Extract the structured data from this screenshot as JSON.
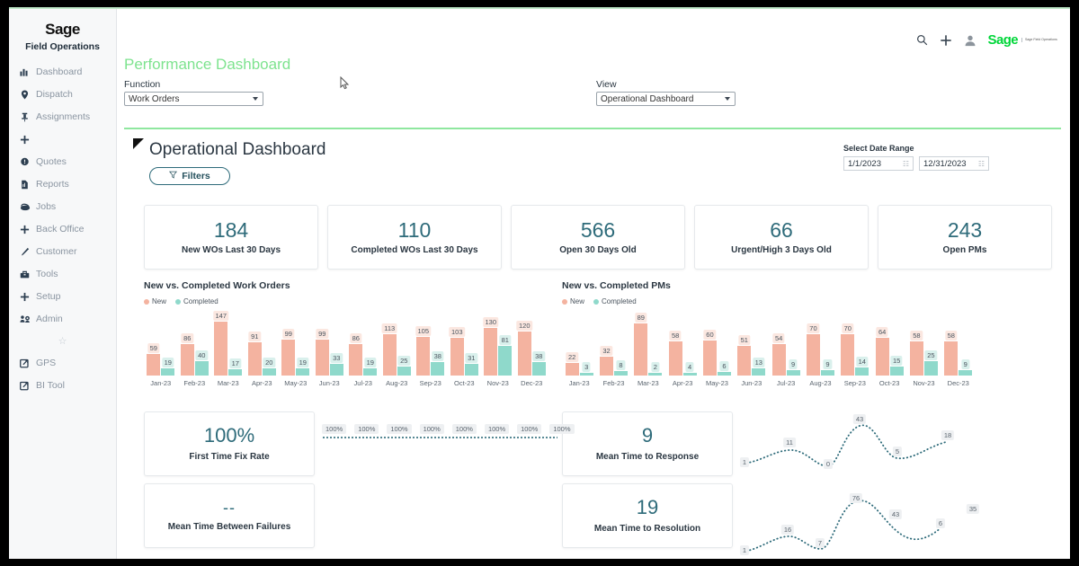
{
  "brand": {
    "logo": "Sage",
    "subtitle": "Field Operations"
  },
  "sidebar": {
    "items": [
      {
        "label": "Dashboard",
        "icon": "chart-bar-icon"
      },
      {
        "label": "Dispatch",
        "icon": "map-pin-icon"
      },
      {
        "label": "Assignments",
        "icon": "pin-icon"
      },
      {
        "label": "",
        "icon": "plus-icon"
      },
      {
        "label": "Quotes",
        "icon": "comment-icon"
      },
      {
        "label": "Reports",
        "icon": "document-icon"
      },
      {
        "label": "Jobs",
        "icon": "briefcase-icon"
      },
      {
        "label": "Back Office",
        "icon": "plus-icon"
      },
      {
        "label": "Customer",
        "icon": "pencil-icon"
      },
      {
        "label": "Tools",
        "icon": "toolbox-icon"
      },
      {
        "label": "Setup",
        "icon": "plus-icon"
      },
      {
        "label": "Admin",
        "icon": "people-gear-icon"
      }
    ],
    "favorite_icon": "star-icon",
    "external": [
      {
        "label": "GPS",
        "icon": "external-link-icon"
      },
      {
        "label": "BI Tool",
        "icon": "external-link-icon"
      }
    ]
  },
  "header": {
    "page_title": "Performance Dashboard",
    "icons": [
      "search-icon",
      "plus-icon",
      "user-avatar-icon"
    ],
    "logo_text": "Sage",
    "logo_sub": "Sage Field Operations"
  },
  "filters": {
    "function_label": "Function",
    "function_value": "Work Orders",
    "view_label": "View",
    "view_value": "Operational Dashboard"
  },
  "dashboard": {
    "title": "Operational Dashboard",
    "filters_button": "Filters",
    "filters_icon": "funnel-icon",
    "date_range_label": "Select Date Range",
    "date_from": "1/1/2023",
    "date_to": "12/31/2023",
    "calendar_icon": "calendar-icon"
  },
  "kpis": [
    {
      "value": "184",
      "label": "New WOs Last 30 Days"
    },
    {
      "value": "110",
      "label": "Completed WOs Last 30 Days"
    },
    {
      "value": "566",
      "label": "Open 30 Days Old"
    },
    {
      "value": "66",
      "label": "Urgent/High 3 Days Old"
    },
    {
      "value": "243",
      "label": "Open PMs"
    }
  ],
  "metric_cards": [
    {
      "value": "100%",
      "label": "First Time Fix Rate"
    },
    {
      "value": "--",
      "label": "Mean Time Between Failures"
    },
    {
      "value": "9",
      "label": "Mean Time to Response"
    },
    {
      "value": "19",
      "label": "Mean Time to Resolution"
    }
  ],
  "colors": {
    "accent_green": "#7ee38f",
    "teal": "#2e6b7a",
    "series_new": "#f4b3a0",
    "series_completed": "#8fd9cb"
  },
  "chart_data": [
    {
      "type": "bar",
      "title": "New vs. Completed Work Orders",
      "categories": [
        "Jan-23",
        "Feb-23",
        "Mar-23",
        "Apr-23",
        "May-23",
        "Jun-23",
        "Jul-23",
        "Aug-23",
        "Sep-23",
        "Oct-23",
        "Nov-23",
        "Dec-23"
      ],
      "series": [
        {
          "name": "New",
          "values": [
            59,
            86,
            147,
            91,
            99,
            99,
            86,
            113,
            105,
            103,
            130,
            120
          ]
        },
        {
          "name": "Completed",
          "values": [
            19,
            40,
            17,
            20,
            19,
            33,
            19,
            25,
            38,
            31,
            81,
            38
          ]
        }
      ],
      "xlabel": "",
      "ylabel": "",
      "ylim": [
        0,
        147
      ],
      "grid": false,
      "legend": "top-left"
    },
    {
      "type": "bar",
      "title": "New vs. Completed PMs",
      "categories": [
        "Jan-23",
        "Feb-23",
        "Mar-23",
        "Apr-23",
        "May-23",
        "Jun-23",
        "Jul-23",
        "Aug-23",
        "Sep-23",
        "Oct-23",
        "Nov-23",
        "Dec-23"
      ],
      "series": [
        {
          "name": "New",
          "values": [
            22,
            32,
            89,
            58,
            60,
            51,
            54,
            70,
            70,
            64,
            58,
            58
          ]
        },
        {
          "name": "Completed",
          "values": [
            3,
            8,
            2,
            4,
            6,
            13,
            9,
            9,
            14,
            15,
            25,
            9
          ]
        }
      ],
      "xlabel": "",
      "ylabel": "",
      "ylim": [
        0,
        89
      ],
      "grid": false,
      "legend": "top-left"
    },
    {
      "type": "line",
      "title": "First Time Fix Rate trend",
      "labels": [
        "100%",
        "100%",
        "100%",
        "100%",
        "100%",
        "100%",
        "100%",
        "100%"
      ],
      "values": [
        100,
        100,
        100,
        100,
        100,
        100,
        100,
        100
      ],
      "ylim": [
        0,
        100
      ],
      "grid": false,
      "legend": "none"
    },
    {
      "type": "line",
      "title": "Mean Time to Response trend",
      "values": [
        1,
        11,
        0,
        43,
        5,
        18
      ],
      "labels": [
        "1",
        "11",
        "0",
        "43",
        "5",
        "18"
      ],
      "ylim": [
        0,
        43
      ],
      "grid": false,
      "legend": "none"
    },
    {
      "type": "line",
      "title": "Mean Time to Resolution trend",
      "values": [
        1,
        16,
        7,
        76,
        43,
        6,
        35
      ],
      "labels": [
        "1",
        "16",
        "7",
        "76",
        "43",
        "6",
        "35"
      ],
      "ylim": [
        0,
        76
      ],
      "grid": false,
      "legend": "none"
    }
  ]
}
